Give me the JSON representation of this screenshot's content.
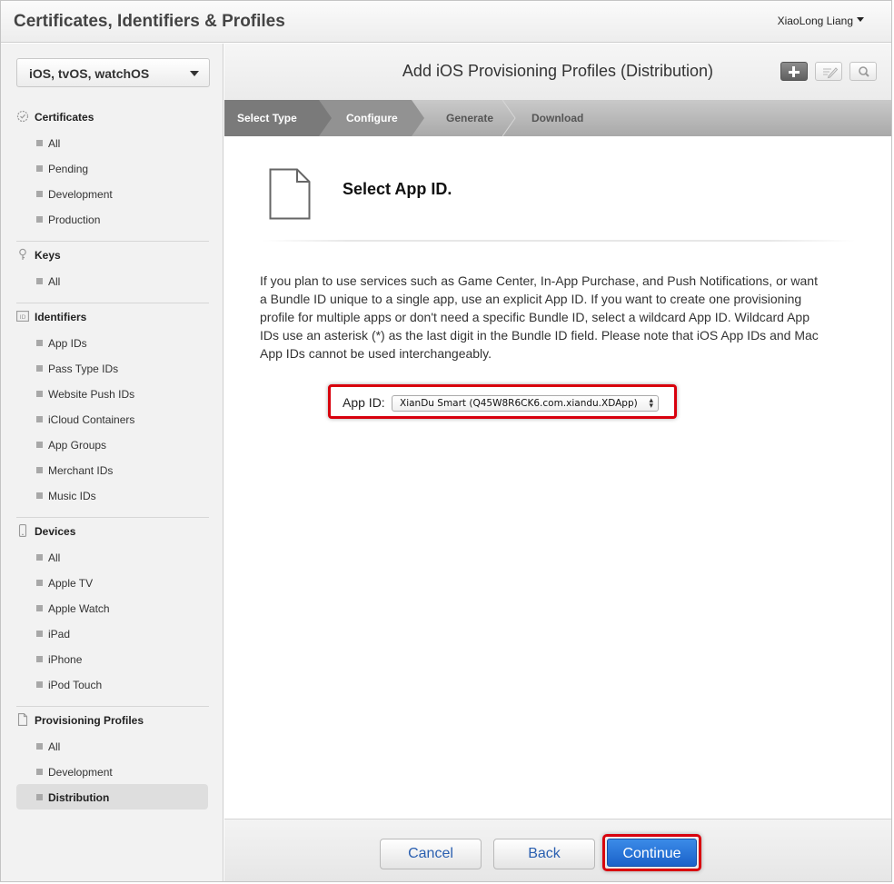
{
  "header": {
    "title": "Certificates, Identifiers & Profiles",
    "user_name": "XiaoLong Liang"
  },
  "sidebar": {
    "platform": "iOS, tvOS, watchOS",
    "sections": [
      {
        "title": "Certificates",
        "icon": "certificate-icon",
        "items": [
          "All",
          "Pending",
          "Development",
          "Production"
        ]
      },
      {
        "title": "Keys",
        "icon": "key-icon",
        "items": [
          "All"
        ]
      },
      {
        "title": "Identifiers",
        "icon": "id-icon",
        "items": [
          "App IDs",
          "Pass Type IDs",
          "Website Push IDs",
          "iCloud Containers",
          "App Groups",
          "Merchant IDs",
          "Music IDs"
        ]
      },
      {
        "title": "Devices",
        "icon": "device-icon",
        "items": [
          "All",
          "Apple TV",
          "Apple Watch",
          "iPad",
          "iPhone",
          "iPod Touch"
        ]
      },
      {
        "title": "Provisioning Profiles",
        "icon": "profile-doc-icon",
        "items": [
          "All",
          "Development",
          "Distribution"
        ],
        "active_item": "Distribution"
      }
    ]
  },
  "main": {
    "title": "Add iOS Provisioning Profiles (Distribution)",
    "steps": [
      "Select Type",
      "Configure",
      "Generate",
      "Download"
    ],
    "current_step": "Configure",
    "section_title": "Select App ID.",
    "description": "If you plan to use services such as Game Center, In-App Purchase, and Push Notifications, or want a Bundle ID unique to a single app, use an explicit App ID. If you want to create one provisioning profile for multiple apps or don't need a specific Bundle ID, select a wildcard App ID. Wildcard App IDs use an asterisk (*) as the last digit in the Bundle ID field. Please note that iOS App IDs and Mac App IDs cannot be used interchangeably.",
    "app_id_label": "App ID:",
    "app_id_value": "XianDu Smart (Q45W8R6CK6.com.xiandu.XDApp)"
  },
  "footer": {
    "cancel": "Cancel",
    "back": "Back",
    "continue": "Continue"
  },
  "colors": {
    "highlight_red": "#d8000d",
    "primary_blue": "#1b62c9",
    "link_blue": "#2a5fb0"
  }
}
